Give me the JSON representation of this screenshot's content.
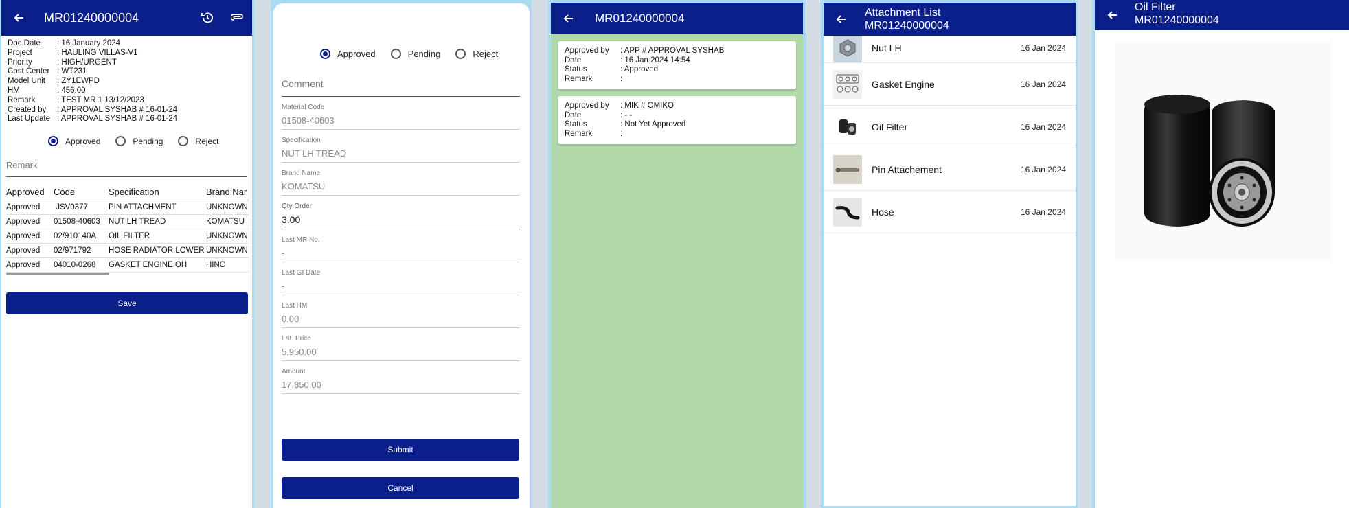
{
  "screen1": {
    "title": "MR01240000004",
    "info": [
      {
        "key": "Doc Date",
        "value": ": 16 January 2024"
      },
      {
        "key": "Project",
        "value": ": HAULING VILLAS-V1"
      },
      {
        "key": "Priority",
        "value": ": HIGH/URGENT"
      },
      {
        "key": "Cost Center",
        "value": ": WT231"
      },
      {
        "key": "Model Unit",
        "value": ": ZY1EWPD"
      },
      {
        "key": "HM",
        "value": ": 456.00"
      },
      {
        "key": "Remark",
        "value": ": TEST MR 1 13/12/2023"
      },
      {
        "key": "Created by",
        "value": ": APPROVAL SYSHAB # 16-01-24"
      },
      {
        "key": "Last Update",
        "value": ": APPROVAL SYSHAB # 16-01-24"
      }
    ],
    "radios": [
      "Approved",
      "Pending",
      "Reject"
    ],
    "remark_placeholder": "Remark",
    "table_headers": [
      "Approved",
      "Code",
      "Specification",
      "Brand Nar"
    ],
    "table_rows": [
      [
        "Approved",
        " JSV0377",
        "PIN ATTACHMENT",
        "UNKNOWN"
      ],
      [
        "Approved",
        "01508-40603",
        "NUT LH TREAD",
        "KOMATSU"
      ],
      [
        "Approved",
        "02/910140A",
        "OIL FILTER",
        "UNKNOWN"
      ],
      [
        "Approved",
        "02/971792",
        "HOSE RADIATOR LOWER",
        "UNKNOWN"
      ],
      [
        "Approved",
        "04010-0268",
        "GASKET ENGINE OH",
        "HINO"
      ]
    ],
    "save_label": "Save"
  },
  "screen2": {
    "radios": [
      "Approved",
      "Pending",
      "Reject"
    ],
    "comment_placeholder": "Comment",
    "fields": [
      {
        "label": "Material Code",
        "value": "01508-40603"
      },
      {
        "label": "Specification",
        "value": "NUT LH TREAD"
      },
      {
        "label": "Brand Name",
        "value": "KOMATSU"
      },
      {
        "label": "Qty Order",
        "value": "3.00"
      },
      {
        "label": "Last MR No.",
        "value": "-"
      },
      {
        "label": "Last GI Date",
        "value": "-"
      },
      {
        "label": "Last HM",
        "value": "0.00"
      },
      {
        "label": "Est. Price",
        "value": "5,950.00"
      },
      {
        "label": "Amount",
        "value": "17,850.00"
      }
    ],
    "submit_label": "Submit",
    "cancel_label": "Cancel"
  },
  "screen3": {
    "title": "MR01240000004",
    "cards": [
      {
        "approved_by": ": APP # APPROVAL SYSHAB",
        "date": ": 16 Jan 2024 14:54",
        "status": ": Approved",
        "remark": ":"
      },
      {
        "approved_by": ": MIK # OMIKO",
        "date": ": - -",
        "status": ": Not Yet Approved",
        "remark": ":"
      }
    ],
    "labels": {
      "approved_by": "Approved by",
      "date": "Date",
      "status": "Status",
      "remark": "Remark"
    }
  },
  "screen4": {
    "title_line1": "Attachment List",
    "title_line2": "MR01240000004",
    "items": [
      {
        "name": "Nut LH",
        "date": "16 Jan 2024"
      },
      {
        "name": "Gasket Engine",
        "date": "16 Jan 2024"
      },
      {
        "name": "Oil Filter",
        "date": "16 Jan 2024"
      },
      {
        "name": "Pin Attachement",
        "date": "16 Jan 2024"
      },
      {
        "name": "Hose",
        "date": "16 Jan 2024"
      }
    ]
  },
  "screen5": {
    "title_line1": "Oil Filter",
    "title_line2": "MR01240000004"
  },
  "colors": {
    "appbar": "#0a1f8a",
    "approval_bg": "#b0d8a8",
    "frame": "#a9dbf2"
  }
}
